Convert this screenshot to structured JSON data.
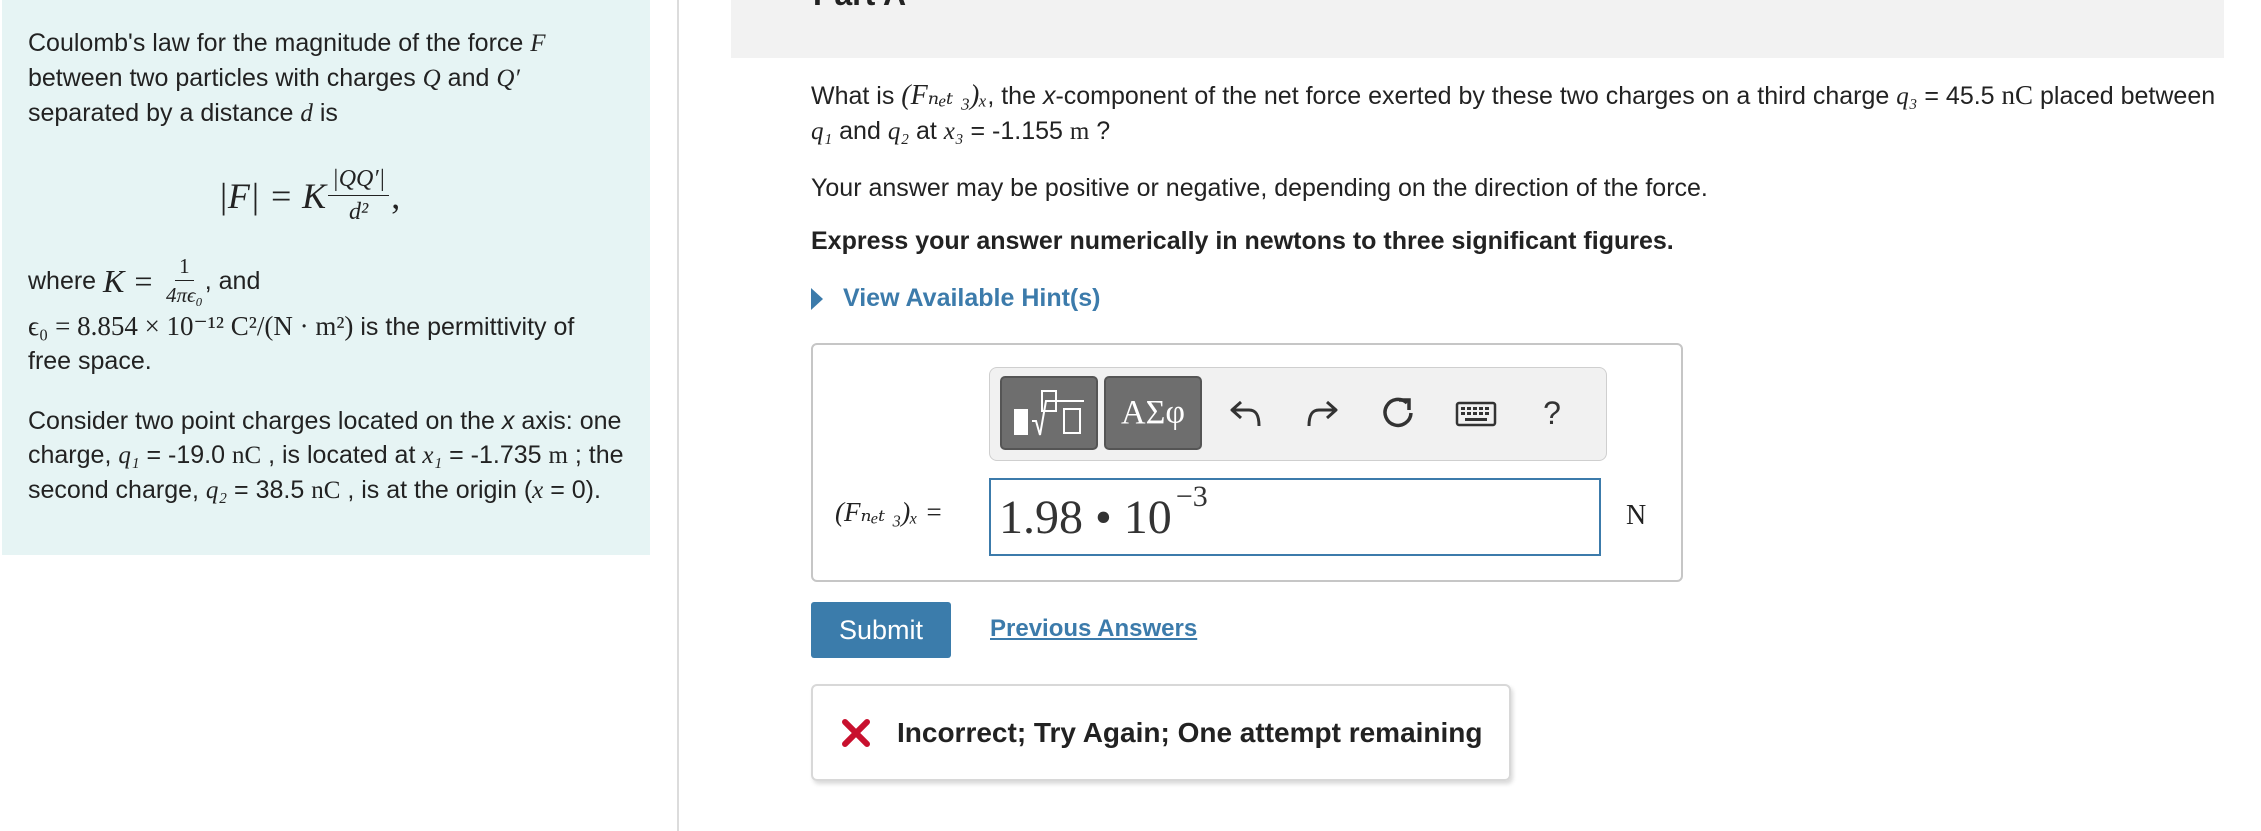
{
  "intro": {
    "p1_a": "Coulomb's law for the magnitude of the force ",
    "p1_F": "F",
    "p1_b": " between two particles with charges ",
    "p1_Q": "Q",
    "p1_c": " and ",
    "p1_Qp": "Q′",
    "p1_d": " separated by a distance ",
    "p1_dvar": "d",
    "p1_e": " is",
    "formula_lhs": "|F| = K",
    "formula_num": "|QQ′|",
    "formula_den": "d²",
    "formula_end": ",",
    "where": "where ",
    "K_eq": "K =",
    "K_num": "1",
    "K_den": "4πϵ₀",
    "and": ", and",
    "eps_value": "ϵ₀ = 8.854 × 10⁻¹² C²/(N · m²)",
    "eps_text": " is the permittivity of free space.",
    "p3_a": "Consider two point charges located on the ",
    "p3_x": "x",
    "p3_b": " axis: one charge, ",
    "q1": "q₁",
    "q1_val": " = -19.0 ",
    "q1_unit": "nC",
    "p3_c": " , is located at ",
    "x1": "x₁",
    "x1_val": " = -1.735 ",
    "x1_unit": "m",
    "p3_d": " ; the second charge, ",
    "q2": "q₂",
    "q2_val": " = 38.5 ",
    "q2_unit": "nC",
    "p3_e": " , is at the origin (",
    "origin": "x",
    "p3_f": " = 0)."
  },
  "part": {
    "title": "Part A"
  },
  "question": {
    "a": "What is ",
    "fnet": "(Fₙₑₜ ₃)ₓ",
    "b": ", the ",
    "x": "x",
    "c": "-component of the net force exerted by these two charges on a third charge ",
    "q3": "q₃",
    "q3_val": " = 45.5 ",
    "q3_unit": "nC",
    "d": " placed between ",
    "q1": "q₁",
    "e": " and ",
    "q2": "q₂",
    "f": " at ",
    "x3": "x₃",
    "x3_val": " = -1.155 ",
    "x3_unit": "m",
    "g": " ?",
    "sign_note": "Your answer may be positive or negative, depending on the direction of the force.",
    "instructions": "Express your answer numerically in newtons to three significant figures.",
    "hint_label": "View Available Hint(s)"
  },
  "toolbar": {
    "greek_label": "ΑΣφ",
    "help_label": "?",
    "icons": [
      "templates-icon",
      "greek-symbols-icon",
      "undo-icon",
      "redo-icon",
      "reset-icon",
      "keyboard-icon",
      "help-icon"
    ]
  },
  "answer": {
    "label": "(Fₙₑₜ ₃)ₓ =",
    "mantissa": "1.98 • 10",
    "exponent": "−3",
    "unit": "N"
  },
  "actions": {
    "submit_label": "Submit",
    "previous_answers_label": "Previous Answers"
  },
  "feedback": {
    "message": "Incorrect; Try Again; One attempt remaining",
    "color": "#c8102e"
  },
  "colors": {
    "accent": "#3b7cab",
    "intro_bg": "#e6f4f4"
  }
}
